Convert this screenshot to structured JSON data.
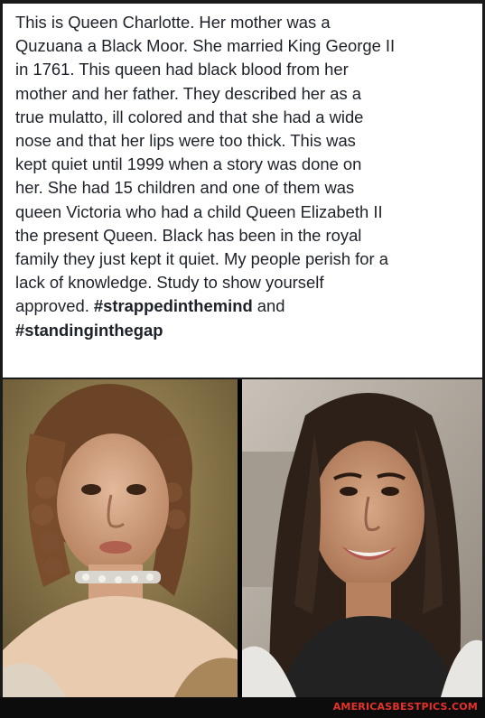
{
  "post": {
    "lines": [
      "This is Queen Charlotte. Her mother was a",
      "Quzuana a Black Moor.  She married King George II",
      "in 1761. This queen had black blood from her",
      "mother and her father. They described her as a",
      "true mulatto, ill colored and that she had a wide",
      "nose and that her lips were too thick. This was",
      "kept quiet until 1999 when a story was done on",
      "her. She had 15 children and one of them was",
      "queen Victoria who had a child Queen Elizabeth II",
      "the present Queen. Black has been in the royal",
      "family they just kept it quiet. My people perish for a",
      "lack of knowledge. Study to show yourself"
    ],
    "last_line_prefix": "approved. ",
    "hashtag_1": "#strappedinthemind",
    "connector": " and",
    "hashtag_2": "#standinginthegap"
  },
  "images": {
    "left": "portrait-painting",
    "right": "smiling-woman-photo"
  },
  "watermark": "AMERICASBESTPICS.COM",
  "colors": {
    "text": "#1d2129",
    "watermark": "#e3322b",
    "card": "#ffffff"
  }
}
